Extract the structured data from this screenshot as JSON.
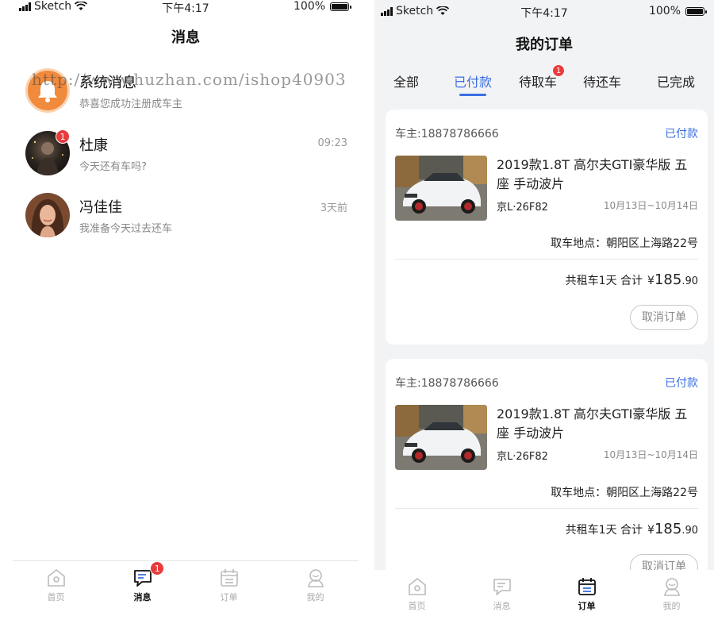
{
  "status_bar": {
    "carrier": "Sketch",
    "time": "下午4:17",
    "battery": "100%"
  },
  "messages_screen": {
    "title": "消息",
    "items": [
      {
        "name": "系统消息",
        "preview": "恭喜您成功注册成车主",
        "time": "",
        "badge": ""
      },
      {
        "name": "杜康",
        "preview": "今天还有车吗?",
        "time": "09:23",
        "badge": "1"
      },
      {
        "name": "冯佳佳",
        "preview": "我准备今天过去还车",
        "time": "3天前",
        "badge": ""
      }
    ],
    "tabbar": [
      {
        "label": "首页",
        "icon": "home-icon"
      },
      {
        "label": "消息",
        "icon": "message-icon",
        "badge": "1"
      },
      {
        "label": "订单",
        "icon": "calendar-icon"
      },
      {
        "label": "我的",
        "icon": "profile-icon"
      }
    ]
  },
  "orders_screen": {
    "title": "我的订单",
    "tabs": [
      {
        "label": "全部"
      },
      {
        "label": "已付款"
      },
      {
        "label": "待取车",
        "badge": "1"
      },
      {
        "label": "待还车"
      },
      {
        "label": "已完成"
      }
    ],
    "orders": [
      {
        "owner": "车主:18878786666",
        "status": "已付款",
        "car_title": "2019款1.8T  高尔夫GTI豪华版  五座 手动波片",
        "plate": "京L·26F82",
        "dates": "10月13日~10月14日",
        "pickup": "取车地点：朝阳区上海路22号",
        "summary_prefix": "共租车1天 合计",
        "currency": "¥",
        "amount_int": "185",
        "amount_dec": ".90",
        "cancel_label": "取消订单"
      },
      {
        "owner": "车主:18878786666",
        "status": "已付款",
        "car_title": "2019款1.8T  高尔夫GTI豪华版  五座 手动波片",
        "plate": "京L·26F82",
        "dates": "10月13日~10月14日",
        "pickup": "取车地点：朝阳区上海路22号",
        "summary_prefix": "共租车1天 合计",
        "currency": "¥",
        "amount_int": "185",
        "amount_dec": ".90",
        "cancel_label": "取消订单"
      }
    ],
    "tabbar": [
      {
        "label": "首页",
        "icon": "home-icon"
      },
      {
        "label": "消息",
        "icon": "message-icon"
      },
      {
        "label": "订单",
        "icon": "calendar-icon"
      },
      {
        "label": "我的",
        "icon": "profile-icon"
      }
    ]
  },
  "watermark": "http://www.huzhan.com/ishop40903",
  "colors": {
    "accent": "#3b6fe0",
    "badge": "#e93b3b",
    "system_avatar": "#f08a3c"
  }
}
